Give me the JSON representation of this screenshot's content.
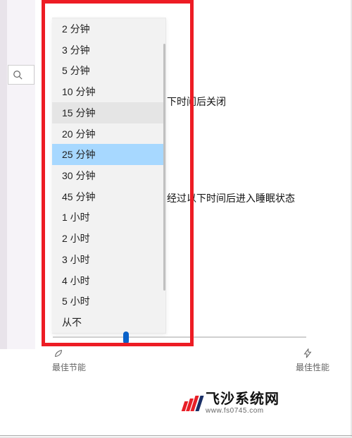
{
  "dropdown": {
    "items": [
      {
        "label": "2 分钟",
        "state": ""
      },
      {
        "label": "3 分钟",
        "state": ""
      },
      {
        "label": "5 分钟",
        "state": ""
      },
      {
        "label": "10 分钟",
        "state": ""
      },
      {
        "label": "15 分钟",
        "state": "hover"
      },
      {
        "label": "20 分钟",
        "state": ""
      },
      {
        "label": "25 分钟",
        "state": "selected"
      },
      {
        "label": "30 分钟",
        "state": ""
      },
      {
        "label": "45 分钟",
        "state": ""
      },
      {
        "label": "1 小时",
        "state": ""
      },
      {
        "label": "2 小时",
        "state": ""
      },
      {
        "label": "3 小时",
        "state": ""
      },
      {
        "label": "4 小时",
        "state": ""
      },
      {
        "label": "5 小时",
        "state": ""
      },
      {
        "label": "从不",
        "state": ""
      }
    ]
  },
  "right": {
    "text1": "下时间后关闭",
    "text2": "经过以下时间后进入睡眠状态"
  },
  "slider": {
    "left_label": "最佳节能",
    "right_label": "最佳性能"
  },
  "watermark": {
    "name": "飞沙系统网",
    "url": "www.fs0745.com"
  }
}
